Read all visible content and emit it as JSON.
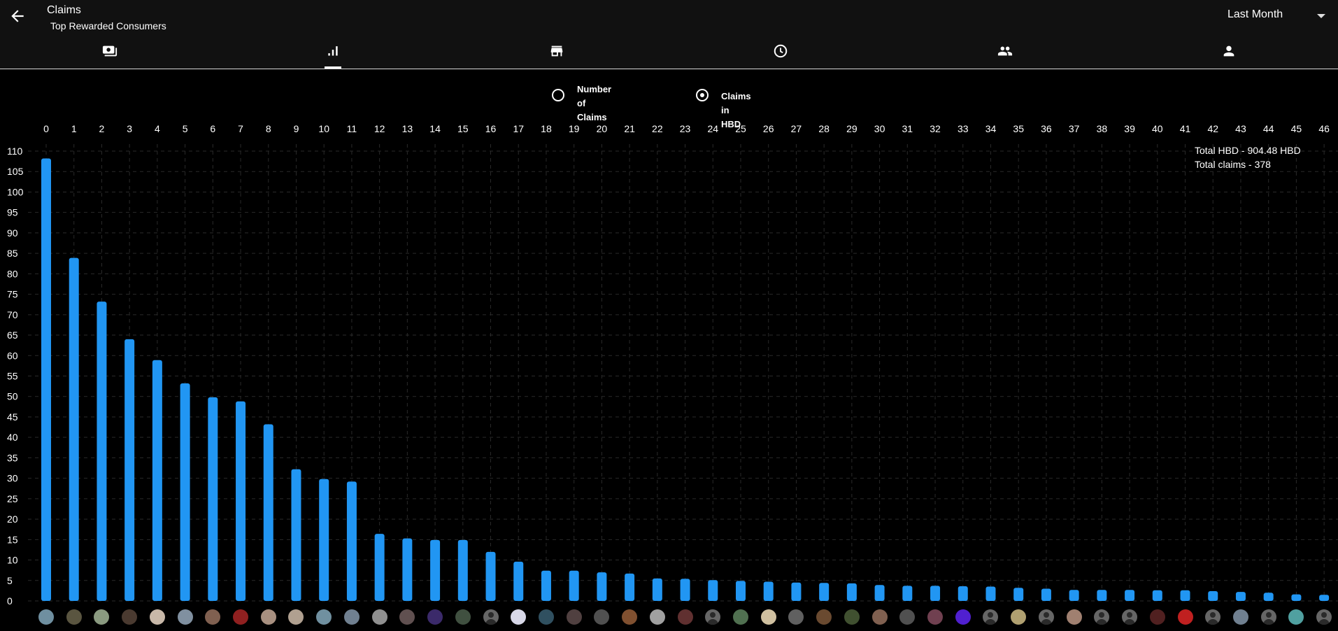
{
  "header": {
    "title": "Claims",
    "subtitle": "Top Rewarded Consumers",
    "period": "Last Month"
  },
  "tabs": [
    {
      "icon": "payments-icon"
    },
    {
      "icon": "bar-chart-icon",
      "active": true
    },
    {
      "icon": "store-icon"
    },
    {
      "icon": "clock-icon"
    },
    {
      "icon": "group-icon"
    },
    {
      "icon": "person-icon"
    }
  ],
  "toggle": {
    "options": [
      {
        "label": "Number of Claims",
        "label_line1": "Number of",
        "label_line2": "Claims",
        "selected": false
      },
      {
        "label": "Claims in HBD",
        "selected": true
      }
    ]
  },
  "totals": {
    "hbd": "Total HBD - 904.48 HBD",
    "claims": "Total claims - 378"
  },
  "colors": {
    "bar": "#2196f3",
    "background": "#000000",
    "appbar": "#111111"
  },
  "chart_data": {
    "type": "bar",
    "categories": [
      "0",
      "1",
      "2",
      "3",
      "4",
      "5",
      "6",
      "7",
      "8",
      "9",
      "10",
      "11",
      "12",
      "13",
      "14",
      "15",
      "16",
      "17",
      "18",
      "19",
      "20",
      "21",
      "22",
      "23",
      "24",
      "25",
      "26",
      "27",
      "28",
      "29",
      "30",
      "31",
      "32",
      "33",
      "34",
      "35",
      "36",
      "37",
      "38",
      "39",
      "40",
      "41",
      "42",
      "43",
      "44",
      "45",
      "46"
    ],
    "values": [
      108.2,
      83.9,
      73.2,
      64.0,
      58.9,
      53.2,
      49.8,
      48.8,
      43.2,
      32.2,
      29.8,
      29.2,
      16.4,
      15.3,
      14.9,
      14.9,
      12.0,
      9.6,
      7.4,
      7.4,
      7.0,
      6.7,
      5.5,
      5.4,
      5.1,
      4.9,
      4.7,
      4.5,
      4.4,
      4.3,
      3.9,
      3.7,
      3.7,
      3.6,
      3.5,
      3.2,
      3.0,
      2.7,
      2.7,
      2.7,
      2.6,
      2.6,
      2.4,
      2.2,
      2.0,
      1.6,
      1.5
    ],
    "ylim": [
      0,
      110
    ],
    "yticks": [
      0,
      5,
      10,
      15,
      20,
      25,
      30,
      35,
      40,
      45,
      50,
      55,
      60,
      65,
      70,
      75,
      80,
      85,
      90,
      95,
      100,
      105,
      110
    ],
    "grid": true,
    "xaxis_position": "top"
  },
  "avatar_colors": [
    "#6f8fa0",
    "#5a5540",
    "#8a9a80",
    "#4a3a30",
    "#c8b8a8",
    "#8090a0",
    "#806050",
    "#902020",
    "#a89080",
    "#b0a090",
    "#7090a0",
    "#708090",
    "#909090",
    "#605050",
    "#3b2a6a",
    "#405040",
    "#444444",
    "#d8d8e8",
    "#305060",
    "#504040",
    "#505050",
    "#805030",
    "#a0a0a0",
    "#603030",
    "#444444",
    "#507050",
    "#d0c0a0",
    "#606060",
    "#6a4a30",
    "#405030",
    "#806050",
    "#505050",
    "#704050",
    "#5020d0",
    "#444444",
    "#b0a070",
    "#444444",
    "#a08070",
    "#444444",
    "#444444",
    "#502020",
    "#c02020",
    "#444444",
    "#708090",
    "#444444",
    "#50a0a0",
    "#444444"
  ],
  "avatar_silhouette": [
    false,
    false,
    false,
    false,
    false,
    false,
    false,
    false,
    false,
    false,
    false,
    false,
    false,
    false,
    false,
    false,
    true,
    false,
    false,
    false,
    false,
    false,
    false,
    false,
    true,
    false,
    false,
    false,
    false,
    false,
    false,
    false,
    false,
    false,
    true,
    false,
    true,
    false,
    true,
    true,
    false,
    false,
    true,
    false,
    true,
    false,
    true
  ]
}
